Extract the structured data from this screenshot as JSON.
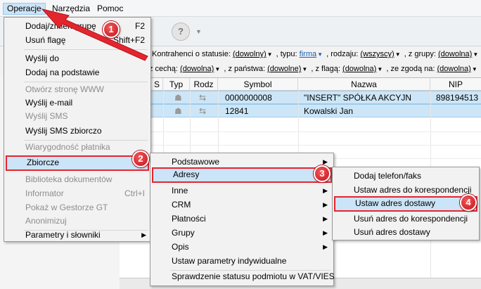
{
  "menubar": {
    "items": [
      "Operacje",
      "Narzędzia",
      "Pomoc"
    ]
  },
  "filters": {
    "row1": {
      "kontrahenci_label": "Kontrahenci o statusie:",
      "status_value": "(dowolny)",
      "typ_label": ", typu:",
      "typ_value": "firma",
      "rodzaj_label": ", rodzaju:",
      "rodzaj_value": "(wszyscy)",
      "grupy_label": ", z grupy:",
      "grupy_value": "(dowolna)"
    },
    "row2": {
      "cecha_label": "z cechą:",
      "cecha_value": "(dowolna)",
      "panstwa_label": ", z państwa:",
      "panstwa_value": "(dowolne)",
      "flaga_label": ", z flagą:",
      "flaga_value": "(dowolna)",
      "zgoda_label": ", ze zgodą na:",
      "zgoda_value": "(dowolna)"
    }
  },
  "grid": {
    "columns": [
      "S",
      "Typ",
      "Rodz",
      "Symbol",
      "Nazwa",
      "NIP"
    ],
    "rows": [
      {
        "symbol": "0000000008",
        "nazwa": "\"INSERT\" SPÓŁKA AKCYJN",
        "nip": "898194513"
      },
      {
        "symbol": "12841",
        "nazwa": "Kowalski Jan",
        "nip": ""
      }
    ]
  },
  "operacje_menu": {
    "items": [
      {
        "label": "Dodaj/zmień grupę",
        "shortcut": "F2",
        "disabled": false
      },
      {
        "label": "Usuń flagę",
        "shortcut": "Shift+F2",
        "disabled": false
      },
      {
        "label": "Wyślij do",
        "shortcut": "",
        "disabled": false
      },
      {
        "label": "Dodaj na podstawie",
        "shortcut": "",
        "disabled": false
      },
      {
        "label": "Otwórz stronę WWW",
        "shortcut": "",
        "disabled": true
      },
      {
        "label": "Wyślij e-mail",
        "shortcut": "",
        "disabled": false
      },
      {
        "label": "Wyślij SMS",
        "shortcut": "",
        "disabled": true
      },
      {
        "label": "Wyślij SMS zbiorczo",
        "shortcut": "",
        "disabled": false
      },
      {
        "label": "Wiarygodność płatnika",
        "shortcut": "",
        "disabled": true
      },
      {
        "label": "Zbiorcze",
        "shortcut": "",
        "disabled": false
      },
      {
        "label": "Biblioteka dokumentów",
        "shortcut": "",
        "disabled": true
      },
      {
        "label": "Informator",
        "shortcut": "Ctrl+I",
        "disabled": true
      },
      {
        "label": "Pokaż w Gestorze GT",
        "shortcut": "",
        "disabled": true
      },
      {
        "label": "Anonimizuj",
        "shortcut": "",
        "disabled": true
      },
      {
        "label": "Parametry i słowniki",
        "shortcut": "",
        "disabled": false
      }
    ]
  },
  "zbiorcze_menu": {
    "items": [
      "Podstawowe",
      "Adresy",
      "Inne",
      "CRM",
      "Płatności",
      "Grupy",
      "Opis",
      "Ustaw parametry indywidualne",
      "Sprawdzenie statusu podmiotu w VAT/VIES"
    ]
  },
  "adresy_menu": {
    "items": [
      "Dodaj telefon/faks",
      "Ustaw adres do korespondencji",
      "Ustaw adres dostawy",
      "Usuń adres do korespondencji",
      "Usuń adres dostawy"
    ]
  },
  "callouts": [
    "1",
    "2",
    "3",
    "4"
  ],
  "colors": {
    "highlight": "#cce4f7",
    "callout_red": "#e3262e",
    "link_blue": "#1a5fb4"
  },
  "icons": {
    "help": "help-question-icon",
    "submenu": "submenu-arrow-icon",
    "contact": "contact-icon",
    "swap": "swap-arrows-icon"
  }
}
